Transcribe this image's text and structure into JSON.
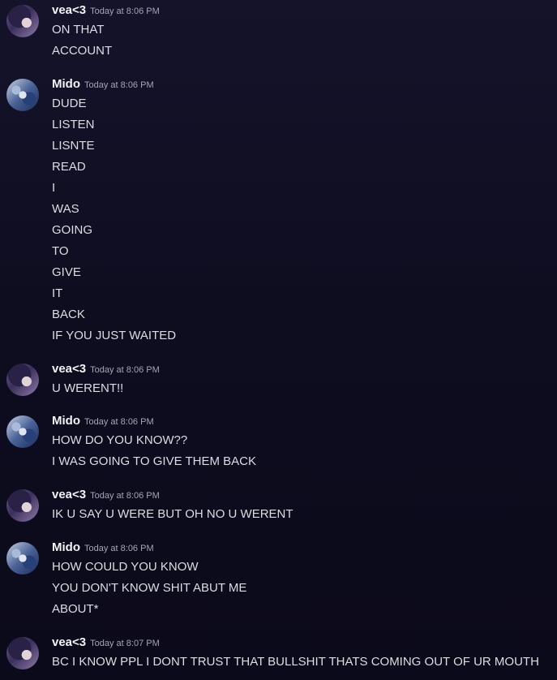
{
  "messages": [
    {
      "author": "vea<3",
      "avatar": "vea",
      "timestamp": "Today at 8:06 PM",
      "lines": [
        "ON THAT",
        "ACCOUNT"
      ]
    },
    {
      "author": "Mido",
      "avatar": "mido",
      "timestamp": "Today at 8:06 PM",
      "lines": [
        "DUDE",
        "LISTEN",
        "LISNTE",
        "READ",
        "I",
        "WAS",
        "GOING",
        "TO",
        "GIVE",
        "IT",
        "BACK",
        "IF YOU JUST WAITED"
      ]
    },
    {
      "author": "vea<3",
      "avatar": "vea",
      "timestamp": "Today at 8:06 PM",
      "lines": [
        "U WERENT!!"
      ]
    },
    {
      "author": "Mido",
      "avatar": "mido",
      "timestamp": "Today at 8:06 PM",
      "lines": [
        "HOW DO YOU KNOW??",
        "I WAS GOING TO GIVE THEM BACK"
      ]
    },
    {
      "author": "vea<3",
      "avatar": "vea",
      "timestamp": "Today at 8:06 PM",
      "lines": [
        "IK U SAY U WERE BUT OH NO U WERENT"
      ]
    },
    {
      "author": "Mido",
      "avatar": "mido",
      "timestamp": "Today at 8:06 PM",
      "lines": [
        "HOW COULD YOU KNOW",
        "YOU DON'T KNOW SHIT ABUT ME",
        "ABOUT*"
      ]
    },
    {
      "author": "vea<3",
      "avatar": "vea",
      "timestamp": "Today at 8:07 PM",
      "lines": [
        "BC I KNOW PPL I DONT TRUST THAT BULLSHIT THATS COMING OUT OF UR MOUTH"
      ]
    }
  ]
}
